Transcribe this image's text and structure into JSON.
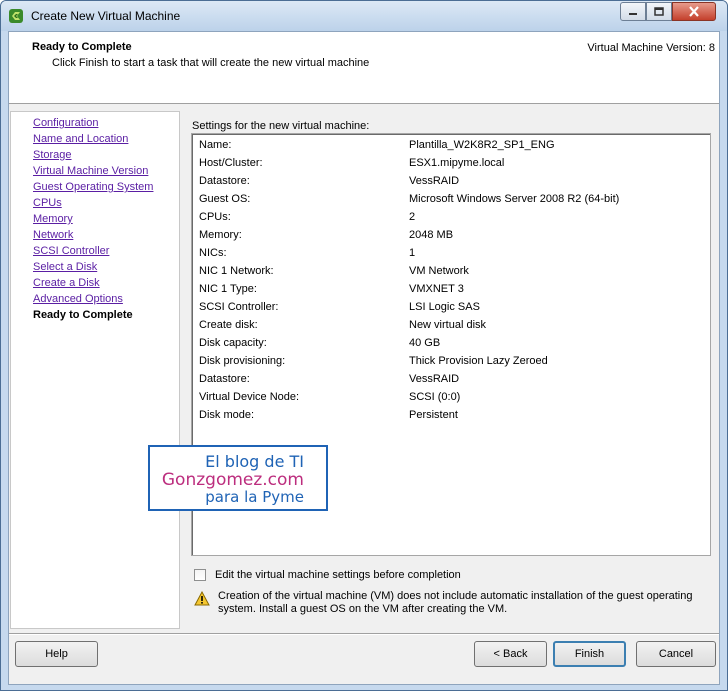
{
  "window": {
    "title": "Create New Virtual Machine",
    "controls": {
      "minimize": "minimize",
      "maximize": "maximize",
      "close": "close"
    }
  },
  "header": {
    "title": "Ready to Complete",
    "subtitle": "Click Finish to start a task that will create the new virtual machine",
    "version": "Virtual Machine Version: 8"
  },
  "steps": [
    {
      "label": "Configuration",
      "current": false
    },
    {
      "label": "Name and Location",
      "current": false
    },
    {
      "label": "Storage",
      "current": false
    },
    {
      "label": "Virtual Machine Version",
      "current": false
    },
    {
      "label": "Guest Operating System",
      "current": false
    },
    {
      "label": "CPUs",
      "current": false
    },
    {
      "label": "Memory",
      "current": false
    },
    {
      "label": "Network",
      "current": false
    },
    {
      "label": "SCSI Controller",
      "current": false
    },
    {
      "label": "Select a Disk",
      "current": false
    },
    {
      "label": "Create a Disk",
      "current": false
    },
    {
      "label": "Advanced Options",
      "current": false
    },
    {
      "label": "Ready to Complete",
      "current": true
    }
  ],
  "settings": {
    "label": "Settings for the new virtual machine:",
    "rows": [
      {
        "key": "Name:",
        "value": "Plantilla_W2K8R2_SP1_ENG"
      },
      {
        "key": "Host/Cluster:",
        "value": "ESX1.mipyme.local"
      },
      {
        "key": "Datastore:",
        "value": "VessRAID"
      },
      {
        "key": "Guest OS:",
        "value": "Microsoft Windows Server 2008 R2 (64-bit)"
      },
      {
        "key": "CPUs:",
        "value": "2"
      },
      {
        "key": "Memory:",
        "value": "2048 MB"
      },
      {
        "key": "NICs:",
        "value": "1"
      },
      {
        "key": "NIC 1 Network:",
        "value": "VM Network"
      },
      {
        "key": "NIC 1 Type:",
        "value": "VMXNET 3"
      },
      {
        "key": "SCSI Controller:",
        "value": "LSI Logic SAS"
      },
      {
        "key": "Create disk:",
        "value": "New virtual disk"
      },
      {
        "key": "Disk capacity:",
        "value": "40 GB"
      },
      {
        "key": "Disk provisioning:",
        "value": "Thick Provision Lazy Zeroed"
      },
      {
        "key": "Datastore:",
        "value": "VessRAID"
      },
      {
        "key": "Virtual Device Node:",
        "value": "SCSI (0:0)"
      },
      {
        "key": "Disk mode:",
        "value": "Persistent"
      }
    ]
  },
  "edit_checkbox": {
    "label": "Edit the virtual machine settings before completion",
    "checked": false
  },
  "warning": {
    "icon": "warning-icon",
    "text": "Creation of the virtual machine (VM) does not include automatic installation of the guest operating system. Install a guest OS on the VM after creating the VM."
  },
  "buttons": {
    "help": "Help",
    "back": "< Back",
    "finish": "Finish",
    "cancel": "Cancel"
  },
  "watermark": {
    "line1": "El blog de TI",
    "line2": "Gonzgomez.com",
    "line3": "para la Pyme"
  },
  "colors": {
    "link": "#5a1ea3",
    "title_bar": "#c6d9ee",
    "close_button": "#c4402c",
    "watermark_blue": "#1f63b5",
    "watermark_pink": "#bc2d7e"
  }
}
